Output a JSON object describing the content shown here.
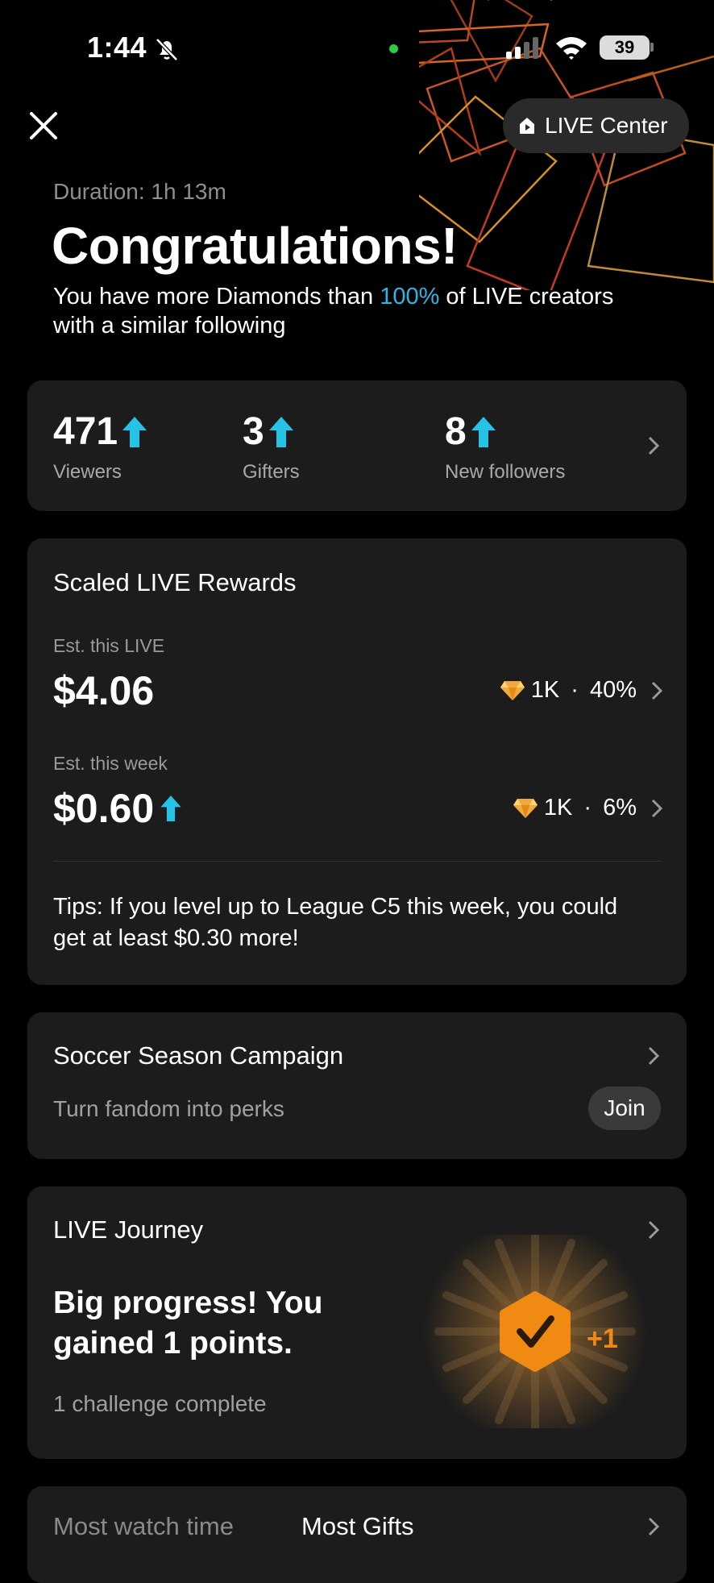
{
  "status_bar": {
    "time": "1:44",
    "battery": "39"
  },
  "header": {
    "live_center_label": "LIVE Center",
    "duration": "Duration: 1h 13m",
    "title": "Congratulations!",
    "subtitle_before": "You have more Diamonds than ",
    "subtitle_highlight": "100%",
    "subtitle_after": " of LIVE creators with a similar following"
  },
  "stats": [
    {
      "value": "471",
      "label": "Viewers"
    },
    {
      "value": "3",
      "label": "Gifters"
    },
    {
      "value": "8",
      "label": "New followers"
    }
  ],
  "rewards": {
    "title": "Scaled LIVE Rewards",
    "live_label": "Est. this LIVE",
    "live_amount": "$4.06",
    "live_diamonds": "1K",
    "live_percent": "40%",
    "week_label": "Est. this week",
    "week_amount": "$0.60",
    "week_diamonds": "1K",
    "week_percent": "6%",
    "tips": "Tips: If you level up to League C5 this week, you could get at least $0.30 more!"
  },
  "campaign": {
    "title": "Soccer Season Campaign",
    "subtitle": "Turn fandom into perks",
    "join_label": "Join"
  },
  "journey": {
    "title": "LIVE Journey",
    "headline": "Big progress! You gained 1 points.",
    "subtitle": "1 challenge complete",
    "points_badge": "+1"
  },
  "bottom_tabs": {
    "tab1": "Most watch time",
    "tab2": "Most Gifts"
  },
  "colors": {
    "accent_blue": "#2bb6e8",
    "stat_arrow": "#25c4e6",
    "badge_orange": "#f08a13",
    "diamond": "#f2a93b"
  }
}
